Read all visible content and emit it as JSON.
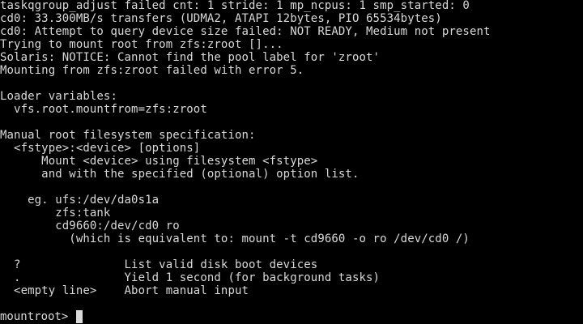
{
  "console": {
    "lines": [
      "taskqgroup_adjust failed cnt: 1 stride: 1 mp_ncpus: 1 smp_started: 0",
      "cd0: 33.300MB/s transfers (UDMA2, ATAPI 12bytes, PIO 65534bytes)",
      "cd0: Attempt to query device size failed: NOT READY, Medium not present",
      "Trying to mount root from zfs:zroot []...",
      "Solaris: NOTICE: Cannot find the pool label for 'zroot'",
      "Mounting from zfs:zroot failed with error 5.",
      "",
      "Loader variables:",
      "  vfs.root.mountfrom=zfs:zroot",
      "",
      "Manual root filesystem specification:",
      "  <fstype>:<device> [options]",
      "      Mount <device> using filesystem <fstype>",
      "      and with the specified (optional) option list.",
      "",
      "    eg. ufs:/dev/da0s1a",
      "        zfs:tank",
      "        cd9660:/dev/cd0 ro",
      "          (which is equivalent to: mount -t cd9660 -o ro /dev/cd0 /)",
      "",
      "  ?               List valid disk boot devices",
      "  .               Yield 1 second (for background tasks)",
      "  <empty line>    Abort manual input",
      ""
    ],
    "prompt": "mountroot> ",
    "input_value": ""
  },
  "colors": {
    "background": "#000000",
    "text": "#d9d9d9",
    "cursor": "#d9d9d9"
  }
}
